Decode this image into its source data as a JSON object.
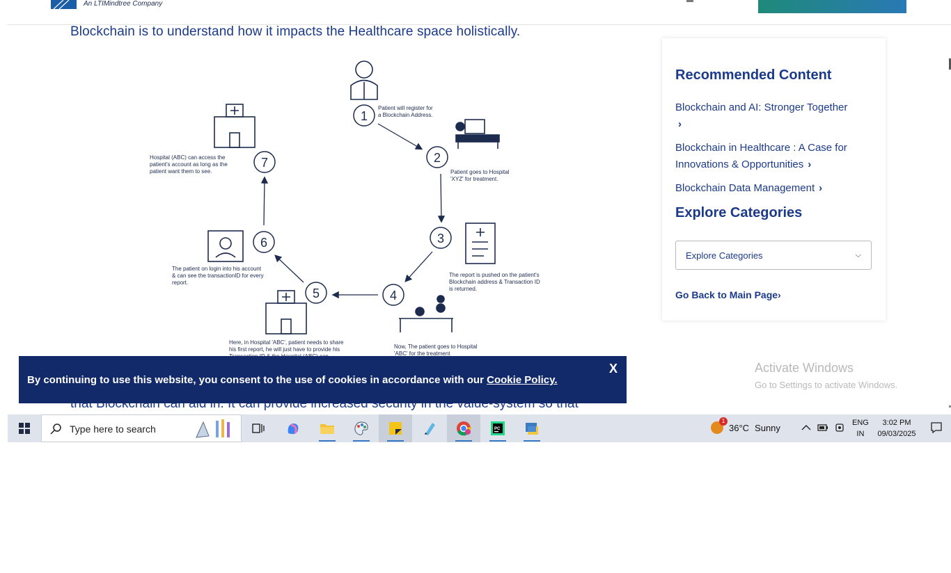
{
  "header": {
    "logo_tagline": "An LTIMindtree Company"
  },
  "article": {
    "line_top": "Blockchain is to understand how it impacts the Healthcare space holistically.",
    "line_bottom": "that Blockchain can aid in. It can provide increased security in the value-system so that"
  },
  "diagram": {
    "steps": [
      {
        "num": "1",
        "text": [
          "Patient will register for",
          "a Blockchain Address."
        ]
      },
      {
        "num": "2",
        "text": [
          "Patient goes to Hospital",
          "'XYZ' for treatment."
        ]
      },
      {
        "num": "3",
        "text": [
          "The report is pushed on the patient's",
          "Blockchain address & Transaction ID",
          "is returned."
        ]
      },
      {
        "num": "4",
        "text": [
          "Now, The patient goes to Hospital",
          "'ABC' for the treatment"
        ]
      },
      {
        "num": "5",
        "text": [
          "Here, in Hospital 'ABC', patient needs to share",
          "his first report, he will just have to provide his",
          "Transaction ID & the Hospital (ABC) can"
        ]
      },
      {
        "num": "6",
        "text": [
          "The patient on login into his account",
          "& can see the transactionID for every",
          "report."
        ]
      },
      {
        "num": "7",
        "text": [
          "Hospital (ABC) can access the",
          "patient's account as long as the",
          "patient want them to see."
        ]
      }
    ]
  },
  "sidebar": {
    "recommended_title": "Recommended Content",
    "links": [
      {
        "label": "Blockchain and AI: Stronger Together"
      },
      {
        "label": "Blockchain in Healthcare : A Case for Innovations & Opportunities"
      },
      {
        "label": "Blockchain Data Management"
      }
    ],
    "chevron": "›",
    "categories_title": "Explore Categories",
    "select_value": "Explore Categories",
    "back_label": "Go Back to Main Page"
  },
  "cookie": {
    "text": "By continuing to use this website, you consent to the use of cookies in accordance with our",
    "link": "Cookie Policy.",
    "close": "X"
  },
  "watermark": {
    "title": "Activate Windows",
    "subtitle": "Go to Settings to activate Windows."
  },
  "taskbar": {
    "search_placeholder": "Type here to search",
    "apps": [
      "task-view",
      "copilot",
      "file-explorer",
      "paint",
      "sticky-notes",
      "notepad",
      "chrome",
      "pycharm",
      "python"
    ],
    "weather_temp": "36°C",
    "weather_cond": "Sunny",
    "weather_badge": "1",
    "lang_top": "ENG",
    "lang_bottom": "IN",
    "time": "3:02 PM",
    "date": "09/03/2025",
    "colors": {
      "accent": "#3a78c5",
      "sticky": "#f4c518",
      "chrome_red": "#db4437",
      "pycharm_green": "#21d789"
    }
  }
}
